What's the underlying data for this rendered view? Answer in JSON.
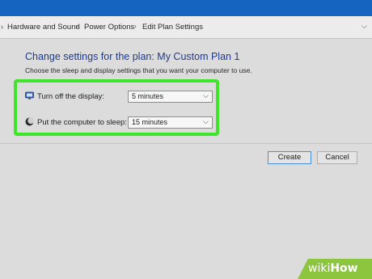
{
  "breadcrumb": {
    "items": [
      "Hardware and Sound",
      "Power Options",
      "Edit Plan Settings"
    ]
  },
  "page": {
    "heading": "Change settings for the plan: My Custom Plan 1",
    "subheading": "Choose the sleep and display settings that you want your computer to use."
  },
  "settings": [
    {
      "label": "Turn off the display:",
      "value": "5 minutes",
      "icon": "monitor-icon"
    },
    {
      "label": "Put the computer to sleep:",
      "value": "15 minutes",
      "icon": "moon-icon"
    }
  ],
  "buttons": {
    "create": "Create",
    "cancel": "Cancel"
  },
  "watermark": {
    "prefix": "wiki",
    "suffix": "How"
  },
  "colors": {
    "accent": "#1565c0",
    "highlight": "#3ee62a",
    "heading": "#1f3a8f"
  }
}
